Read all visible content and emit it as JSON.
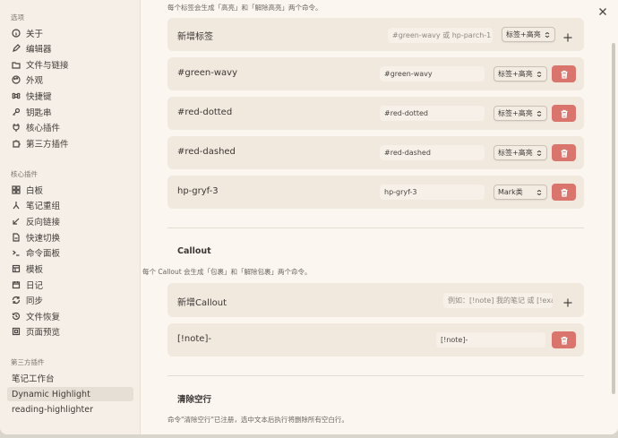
{
  "sidebar": {
    "group_options": "选项",
    "group_core": "核心插件",
    "group_third": "第三方插件",
    "options": [
      {
        "label": "关于",
        "icon": "info-icon"
      },
      {
        "label": "编辑器",
        "icon": "edit-icon"
      },
      {
        "label": "文件与链接",
        "icon": "folder-icon"
      },
      {
        "label": "外观",
        "icon": "palette-icon"
      },
      {
        "label": "快捷键",
        "icon": "command-icon"
      },
      {
        "label": "钥匙串",
        "icon": "key-icon"
      },
      {
        "label": "核心插件",
        "icon": "plug-icon"
      },
      {
        "label": "第三方插件",
        "icon": "puzzle-icon"
      }
    ],
    "core": [
      {
        "label": "白板",
        "icon": "grid-icon"
      },
      {
        "label": "笔记重组",
        "icon": "merge-icon"
      },
      {
        "label": "反向链接",
        "icon": "backlink-icon"
      },
      {
        "label": "快速切换",
        "icon": "switch-icon"
      },
      {
        "label": "命令面板",
        "icon": "terminal-icon"
      },
      {
        "label": "模板",
        "icon": "template-icon"
      },
      {
        "label": "日记",
        "icon": "calendar-icon"
      },
      {
        "label": "同步",
        "icon": "sync-icon"
      },
      {
        "label": "文件恢复",
        "icon": "history-icon"
      },
      {
        "label": "页面预览",
        "icon": "preview-icon"
      }
    ],
    "third": [
      "笔记工作台",
      "Dynamic Highlight",
      "reading-highlighter"
    ]
  },
  "main": {
    "tags_desc": "每个标签会生成「高亮」和「解除高亮」两个命令。",
    "new_tag": {
      "label": "新增标签",
      "placeholder": "#green-wavy 或 hp-parch-1",
      "select": "标签+高亮"
    },
    "tags": [
      {
        "label": "#green-wavy",
        "value": "#green-wavy",
        "select": "标签+高亮"
      },
      {
        "label": "#red-dotted",
        "value": "#red-dotted",
        "select": "标签+高亮"
      },
      {
        "label": "#red-dashed",
        "value": "#red-dashed",
        "select": "标签+高亮"
      },
      {
        "label": "hp-gryf-3",
        "value": "hp-gryf-3",
        "select": "Mark类"
      }
    ],
    "callout_title": "Callout",
    "callout_desc": "每个 Callout 会生成「包裹」和「解除包裹」两个命令。",
    "new_callout": {
      "label": "新增Callout",
      "placeholder": "例如：[!note] 我的笔记 或 [!exa"
    },
    "callouts": [
      {
        "label": "[!note]-",
        "value": "[!note]-"
      }
    ],
    "clear_title": "清除空行",
    "clear_desc": "命令\"清除空行\"已注册，选中文本后执行将删除所有空白行。"
  }
}
